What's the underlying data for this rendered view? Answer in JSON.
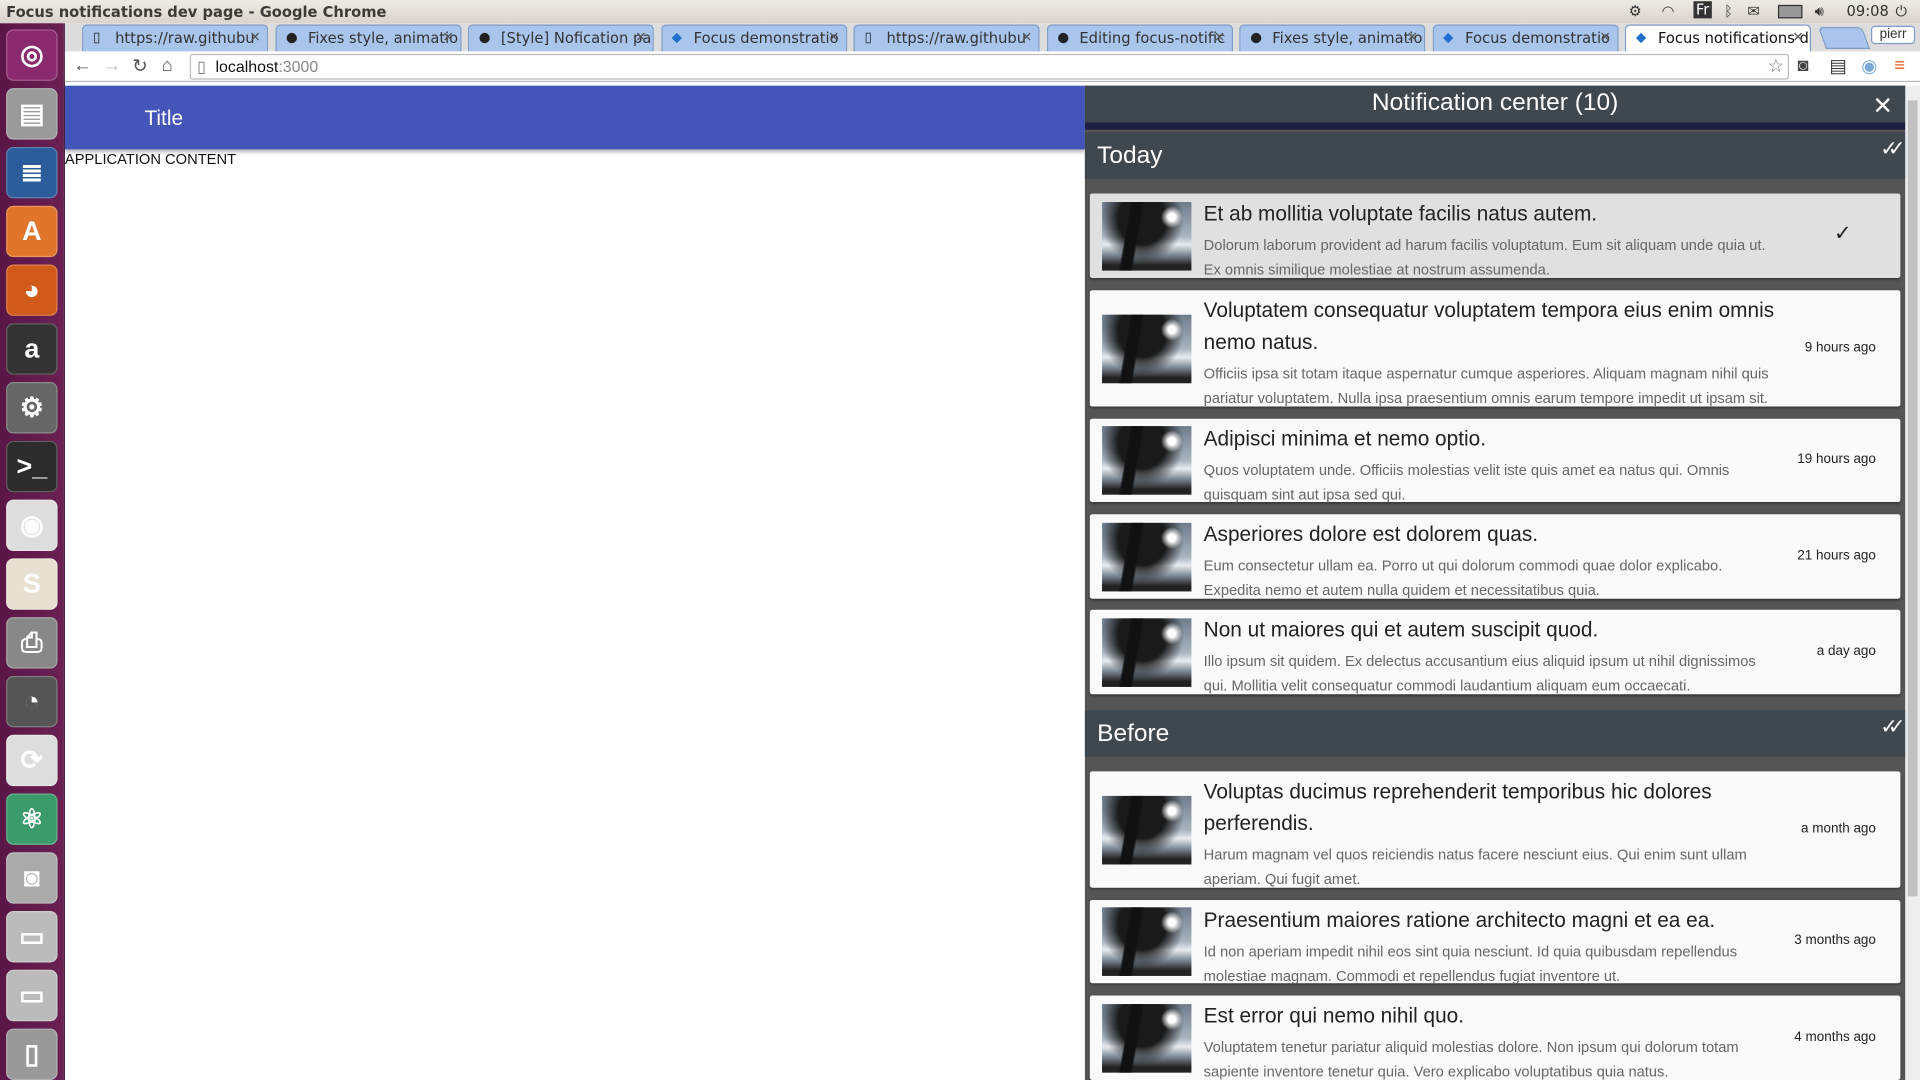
{
  "window_title": "Focus notifications dev page - Google Chrome",
  "tray": {
    "clock": "09:08",
    "keyboard": "Fr",
    "user": "pierr",
    "icons": [
      "settings-icon",
      "wifi-icon",
      "keyboard-layout-icon",
      "bluetooth-icon",
      "mail-icon",
      "battery-icon",
      "volume-icon",
      "power-icon"
    ]
  },
  "launcher": [
    "ubuntu-dash-icon",
    "files-icon",
    "libreoffice-writer-icon",
    "software-center-icon",
    "firefox-icon",
    "amazon-icon",
    "system-settings-icon",
    "terminal-icon",
    "chrome-icon",
    "slack-icon",
    "scanner-icon",
    "gimp-icon",
    "update-manager-icon",
    "atom-icon",
    "camera-icon",
    "drive-icon",
    "drive-icon",
    "trash-icon"
  ],
  "tabs": [
    {
      "label": "https://raw.githubu",
      "icon": "page-icon"
    },
    {
      "label": "Fixes style, animatio",
      "icon": "github-icon"
    },
    {
      "label": "[Style] Nofication pa",
      "icon": "github-icon"
    },
    {
      "label": "Focus demonstratio",
      "icon": "focus-icon"
    },
    {
      "label": "https://raw.githubu",
      "icon": "page-icon"
    },
    {
      "label": "Editing focus-notific",
      "icon": "github-icon"
    },
    {
      "label": "Fixes style, animatio",
      "icon": "github-icon"
    },
    {
      "label": "Focus demonstratio",
      "icon": "focus-icon"
    },
    {
      "label": "Focus notifications d",
      "icon": "focus-icon",
      "active": true
    }
  ],
  "address": {
    "host": "localhost",
    "port": ":3000"
  },
  "app": {
    "title": "Title",
    "content": "APPLICATION CONTENT",
    "header_color": "#4355b9"
  },
  "panel": {
    "title": "Notification center (10)",
    "sections": [
      {
        "label": "Today",
        "items": [
          {
            "title": "Et ab mollitia voluptate facilis natus autem.",
            "body": "Dolorum laborum provident ad harum facilis voluptatum. Eum sit aliquam unde quia ut. Ex omnis similique molestiae at nostrum assumenda.",
            "time": "",
            "selected": true
          },
          {
            "title": "Voluptatem consequatur voluptatem tempora eius enim omnis nemo natus.",
            "body": "Officiis ipsa sit totam itaque aspernatur cumque asperiores. Aliquam magnam nihil quis pariatur voluptatem. Nulla ipsa praesentium omnis earum tempore impedit ut ipsam sit.",
            "time": "9 hours ago"
          },
          {
            "title": "Adipisci minima et nemo optio.",
            "body": "Quos voluptatem unde. Officiis molestias velit iste quis amet ea natus qui. Omnis quisquam sint aut ipsa sed qui.",
            "time": "19 hours ago"
          },
          {
            "title": "Asperiores dolore est dolorem quas.",
            "body": "Eum consectetur ullam ea. Porro ut qui dolorum commodi quae dolor explicabo. Expedita nemo et autem nulla quidem et necessitatibus quia.",
            "time": "21 hours ago"
          },
          {
            "title": "Non ut maiores qui et autem suscipit quod.",
            "body": "Illo ipsum sit quidem. Ex delectus accusantium eius aliquid ipsum ut nihil dignissimos qui. Mollitia velit consequatur commodi laudantium aliquam eum occaecati.",
            "time": "a day ago"
          }
        ]
      },
      {
        "label": "Before",
        "items": [
          {
            "title": "Voluptas ducimus reprehenderit temporibus hic dolores perferendis.",
            "body": "Harum magnam vel quos reiciendis natus facere nesciunt eius. Qui enim sunt ullam aperiam. Qui fugit amet.",
            "time": "a month ago"
          },
          {
            "title": "Praesentium maiores ratione architecto magni et ea ea.",
            "body": "Id non aperiam impedit nihil eos sint quia nesciunt. Id quia quibusdam repellendus molestiae magnam. Commodi et repellendus fugiat inventore ut.",
            "time": "3 months ago"
          },
          {
            "title": "Est error qui nemo nihil quo.",
            "body": "Voluptatem tenetur pariatur aliquid molestias dolore. Non ipsum qui dolorum totam sapiente inventore tenetur quia. Vero explicabo voluptatibus quia natus.",
            "time": "4 months ago"
          }
        ]
      }
    ]
  }
}
